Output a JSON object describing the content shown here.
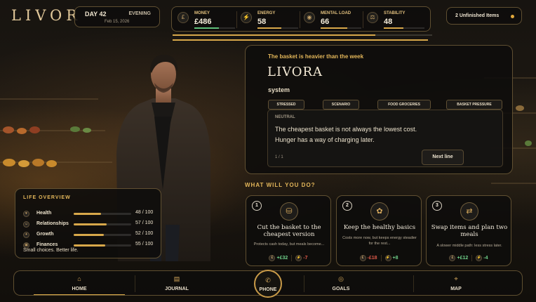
{
  "brand": {
    "logo": "LIVOR"
  },
  "day": {
    "label": "DAY 42",
    "period": "EVENING",
    "date": "Feb 15, 2026"
  },
  "stats": [
    {
      "name": "MONEY",
      "value": "£486",
      "icon": "coin-icon",
      "fill": 0.6,
      "color": "#5fbf7a"
    },
    {
      "name": "ENERGY",
      "value": "58",
      "icon": "lightning-icon",
      "fill": 0.58,
      "color": "#d8a84a"
    },
    {
      "name": "MENTAL LOAD",
      "value": "66",
      "icon": "brain-icon",
      "fill": 0.66,
      "color": "#d8a84a"
    },
    {
      "name": "STABILITY",
      "value": "48",
      "icon": "balance-icon",
      "fill": 0.48,
      "color": "#d8a84a"
    }
  ],
  "loading": {
    "bar1_fill": 0.78,
    "bar2_fill": 1.0
  },
  "unfinished": {
    "label": "2 Unfinished Items"
  },
  "dialogue": {
    "kicker": "The basket is heavier than the week",
    "speaker": "LIVORA",
    "role": "system",
    "tags": [
      "STRESSED",
      "SCENARIO",
      "FOOD GROCERIES",
      "BASKET PRESSURE"
    ],
    "mood": "NEUTRAL",
    "line1": "The cheapest basket is not always the lowest cost.",
    "line2": "Hunger has a way of charging later.",
    "progress": "1 / 1",
    "next_label": "Next line"
  },
  "prompt": "WHAT WILL YOU DO?",
  "choices": [
    {
      "number": "1",
      "icon": "basket-icon",
      "title": "Cut the basket to the cheapest version",
      "desc": "Protects cash today, but meals become...",
      "effects": [
        {
          "icon": "money-icon",
          "text": "+£32",
          "color": "#6fd08a"
        },
        {
          "icon": "energy-icon",
          "text": "-7",
          "color": "#e05a4a"
        }
      ]
    },
    {
      "number": "2",
      "icon": "leaf-icon",
      "title": "Keep the healthy basics",
      "desc": "Costs more now, but keeps energy steadier for the rest...",
      "effects": [
        {
          "icon": "money-icon",
          "text": "-£18",
          "color": "#e05a4a"
        },
        {
          "icon": "energy-icon",
          "text": "+8",
          "color": "#6fd08a"
        }
      ]
    },
    {
      "number": "3",
      "icon": "swap-icon",
      "title": "Swap items and plan two meals",
      "desc": "A slower middle path: less stress later.",
      "effects": [
        {
          "icon": "money-icon",
          "text": "+£12",
          "color": "#6fd08a"
        },
        {
          "icon": "energy-icon",
          "text": "-4",
          "color": "#6fd08a"
        }
      ]
    }
  ],
  "life": {
    "title": "LIFE OVERVIEW",
    "rows": [
      {
        "label": "Health",
        "value": "48 / 100",
        "fill": 0.48,
        "icon": "heart-icon"
      },
      {
        "label": "Relationships",
        "value": "57 / 100",
        "fill": 0.57,
        "icon": "people-icon"
      },
      {
        "label": "Growth",
        "value": "52 / 100",
        "fill": 0.52,
        "icon": "sprout-icon"
      },
      {
        "label": "Finances",
        "value": "55 / 100",
        "fill": 0.55,
        "icon": "wallet-icon"
      }
    ],
    "tagline": "Small choices. Better life."
  },
  "nav": {
    "home": {
      "label": "HOME",
      "icon": "home-icon"
    },
    "journal": {
      "label": "JOURNAL",
      "icon": "journal-icon"
    },
    "phone": {
      "label": "PHONE",
      "icon": "phone-icon"
    },
    "goals": {
      "label": "GOALS",
      "icon": "target-icon"
    },
    "map": {
      "label": "MAP",
      "icon": "map-icon"
    }
  },
  "colors": {
    "accent": "#e3b65a",
    "positive": "#6fd08a",
    "negative": "#e05a4a",
    "panel": "#0e0d0b"
  }
}
